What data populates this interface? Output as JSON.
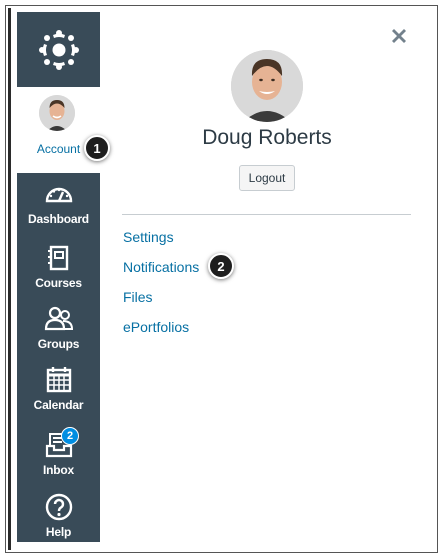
{
  "sidebar": {
    "logo_icon": "canvas-logo-icon",
    "account": {
      "label": "Account",
      "avatar": "user-avatar"
    },
    "items": [
      {
        "id": "dashboard",
        "label": "Dashboard",
        "icon": "dashboard-icon"
      },
      {
        "id": "courses",
        "label": "Courses",
        "icon": "courses-icon"
      },
      {
        "id": "groups",
        "label": "Groups",
        "icon": "groups-icon"
      },
      {
        "id": "calendar",
        "label": "Calendar",
        "icon": "calendar-icon"
      },
      {
        "id": "inbox",
        "label": "Inbox",
        "icon": "inbox-icon",
        "badge": "2"
      },
      {
        "id": "help",
        "label": "Help",
        "icon": "help-icon"
      }
    ],
    "colors": {
      "background": "#394b58",
      "active_text": "#0770a3",
      "badge": "#008ee2"
    }
  },
  "panel": {
    "user_name": "Doug Roberts",
    "logout_label": "Logout",
    "close_icon": "close-icon",
    "links": [
      {
        "id": "settings",
        "label": "Settings"
      },
      {
        "id": "notifications",
        "label": "Notifications"
      },
      {
        "id": "files",
        "label": "Files"
      },
      {
        "id": "eportfolios",
        "label": "ePortfolios"
      }
    ],
    "link_color": "#0770a3"
  },
  "callouts": [
    "1",
    "2"
  ]
}
